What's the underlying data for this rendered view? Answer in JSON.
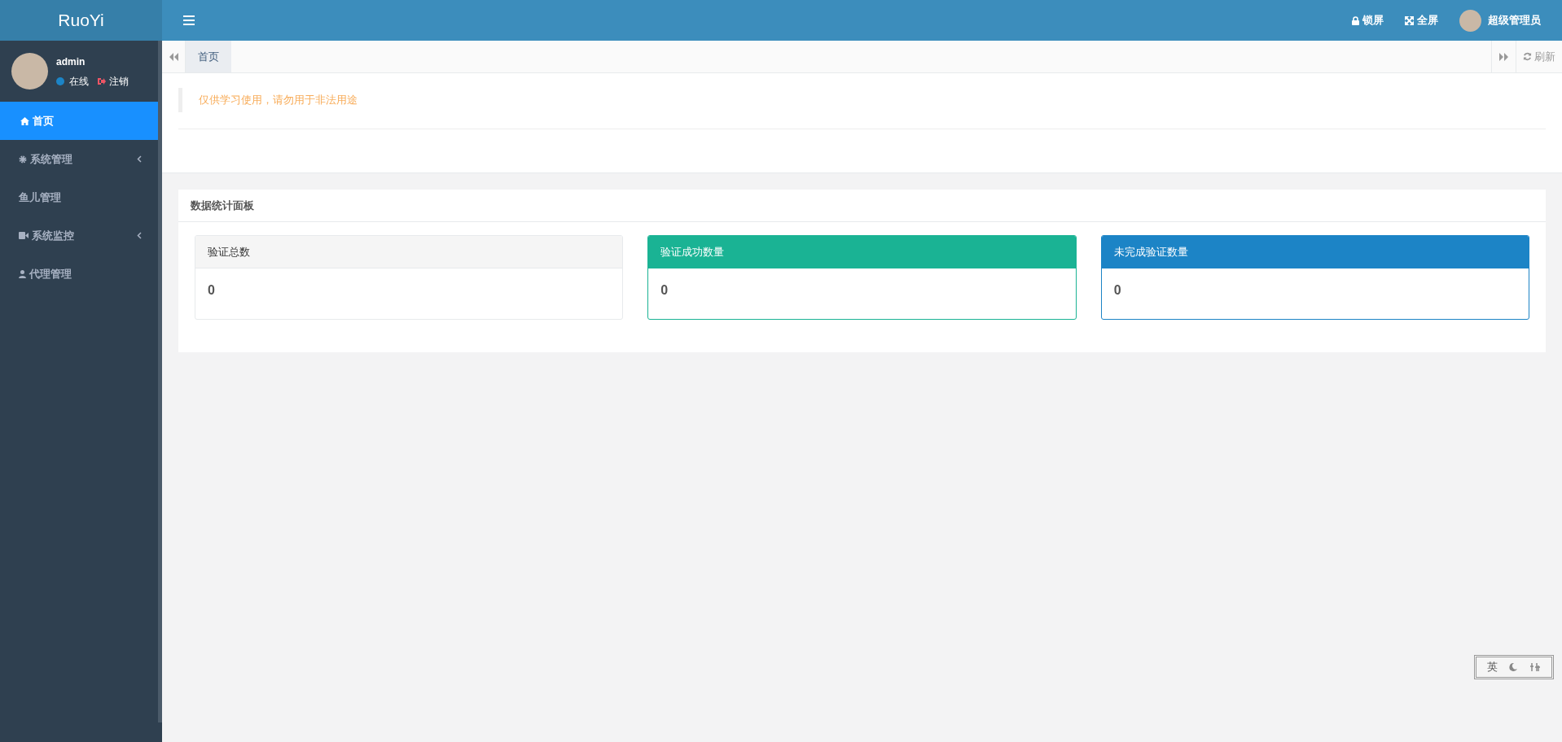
{
  "brand": "RuoYi",
  "header": {
    "actions": [
      {
        "kind": "lock",
        "label": "锁屏"
      },
      {
        "kind": "fullscreen",
        "label": "全屏"
      },
      {
        "kind": "user",
        "label": "超级管理员"
      }
    ]
  },
  "user_panel": {
    "name": "admin",
    "status": "在线",
    "logout": "注销"
  },
  "sidebar": {
    "items": [
      {
        "kind": "home",
        "label": "首页",
        "selected": true,
        "has_children": false
      },
      {
        "kind": "gear",
        "label": "系统管理",
        "selected": false,
        "has_children": true
      },
      {
        "kind": "plain",
        "label": "鱼儿管理",
        "selected": false,
        "has_children": false
      },
      {
        "kind": "video",
        "label": "系统监控",
        "selected": false,
        "has_children": true
      },
      {
        "kind": "user",
        "label": "代理管理",
        "selected": false,
        "has_children": false
      }
    ]
  },
  "tabs": [
    {
      "label": "首页",
      "selected": true
    }
  ],
  "refresh": "刷新",
  "notice": "仅供学习使用，请勿用于非法用途",
  "panel": {
    "title": "数据统计面板",
    "cards": [
      {
        "kind": "default",
        "title": "验证总数",
        "value": "0"
      },
      {
        "kind": "success",
        "title": "验证成功数量",
        "value": "0"
      },
      {
        "kind": "primary",
        "title": "未完成验证数量",
        "value": "0"
      }
    ]
  },
  "ime": {
    "mode": "英"
  }
}
